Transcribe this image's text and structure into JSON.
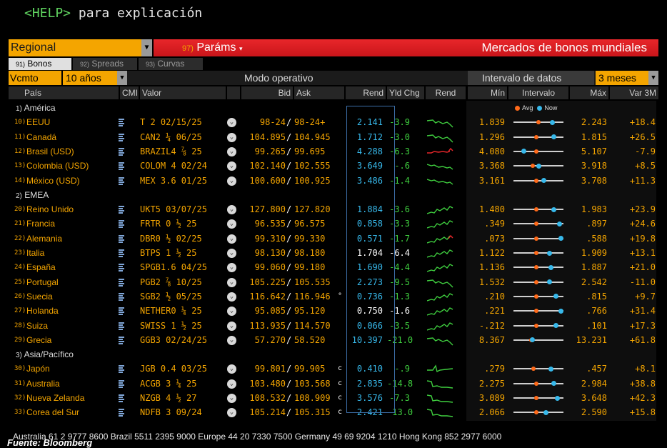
{
  "help": {
    "key": "<HELP>",
    "text": "para explicación"
  },
  "toolbar": {
    "region": "Regional",
    "params_num": "97)",
    "params_label": "Paráms",
    "title": "Mercados de bonos mundiales"
  },
  "tabs": [
    {
      "num": "91)",
      "label": "Bonos",
      "active": true
    },
    {
      "num": "92)",
      "label": "Spreads",
      "active": false
    },
    {
      "num": "93)",
      "label": "Curvas",
      "active": false
    }
  ],
  "controls": {
    "vcmto": "Vcmto",
    "anios": "10 años",
    "modo": "Modo operativo",
    "intervalo": "Intervalo de datos",
    "meses": "3 meses"
  },
  "headers": {
    "pais": "País",
    "cmi": "CMI",
    "valor": "Valor",
    "bid": "Bid",
    "ask": "Ask",
    "rend": "Rend",
    "yldchg": "Yld Chg",
    "rend2": "Rend",
    "min": "Mín",
    "intervalo": "Intervalo",
    "max": "Máx",
    "var": "Var 3M"
  },
  "legend": {
    "avg": "Avg",
    "now": "Now"
  },
  "colors": {
    "accent": "#f4a500",
    "blue": "#37b8ea",
    "green": "#3fcf3f",
    "red": "#e8262a",
    "orange_dot": "#ff6a1a"
  },
  "groups": [
    {
      "num": "1)",
      "name": "América"
    },
    {
      "num": "2)",
      "name": "EMEA"
    },
    {
      "num": "3)",
      "name": "Asia/Pacífico"
    }
  ],
  "rows": [
    {
      "n": "10)",
      "pais": "EEUU",
      "valor": "T 2 02/15/25",
      "bid": "98-24",
      "ask": "98-24+",
      "flag": "",
      "rend": "2.141",
      "chg": "-3.9",
      "min": "1.839",
      "max": "2.243",
      "var": "+18.4",
      "avg": 0.5,
      "now": 0.78,
      "rendwhite": false,
      "spark": "down"
    },
    {
      "n": "11)",
      "pais": "Canadá",
      "valor": "CAN2 ¼ 06/25",
      "bid": "104.895",
      "ask": "104.945",
      "flag": "",
      "rend": "1.712",
      "chg": "-3.0",
      "min": "1.296",
      "max": "1.815",
      "var": "+26.5",
      "avg": 0.45,
      "now": 0.8,
      "rendwhite": false,
      "spark": "down"
    },
    {
      "n": "12)",
      "pais": "Brasil (USD)",
      "valor": "BRAZIL4 ⅞ 25",
      "bid": "99.265",
      "ask": "99.695",
      "flag": "",
      "rend": "4.288",
      "chg": "-6.3",
      "min": "4.080",
      "max": "5.107",
      "var": "-7.9",
      "avg": 0.45,
      "now": 0.2,
      "rendwhite": false,
      "spark": "redflat"
    },
    {
      "n": "13)",
      "pais": "Colombia (USD)",
      "valor": "COLOM 4 02/24",
      "bid": "102.140",
      "ask": "102.555",
      "flag": "",
      "rend": "3.649",
      "chg": "-.6",
      "min": "3.368",
      "max": "3.918",
      "var": "+8.5",
      "avg": 0.38,
      "now": 0.51,
      "rendwhite": false,
      "spark": "flat"
    },
    {
      "n": "14)",
      "pais": "México (USD)",
      "valor": "MEX 3.6 01/25",
      "bid": "100.600",
      "ask": "100.925",
      "flag": "",
      "rend": "3.486",
      "chg": "-1.4",
      "min": "3.161",
      "max": "3.708",
      "var": "+11.3",
      "avg": 0.45,
      "now": 0.6,
      "rendwhite": false,
      "spark": "flat"
    },
    {
      "n": "20)",
      "pais": "Reino Unido",
      "valor": "UKT5 03/07/25",
      "bid": "127.800",
      "ask": "127.820",
      "flag": "",
      "rend": "1.884",
      "chg": "-3.6",
      "min": "1.480",
      "max": "1.983",
      "var": "+23.9",
      "avg": 0.45,
      "now": 0.8,
      "rendwhite": false,
      "spark": "up"
    },
    {
      "n": "21)",
      "pais": "Francia",
      "valor": "FRTR 0 ½ 25",
      "bid": "96.535",
      "ask": "96.575",
      "flag": "",
      "rend": "0.858",
      "chg": "-3.3",
      "min": ".349",
      "max": ".897",
      "var": "+24.6",
      "avg": 0.45,
      "now": 0.92,
      "rendwhite": false,
      "spark": "up"
    },
    {
      "n": "22)",
      "pais": "Alemania",
      "valor": "DBR0 ½ 02/25",
      "bid": "99.310",
      "ask": "99.330",
      "flag": "",
      "rend": "0.571",
      "chg": "-1.7",
      "min": ".073",
      "max": ".588",
      "var": "+19.8",
      "avg": 0.45,
      "now": 0.95,
      "rendwhite": false,
      "spark": "upred"
    },
    {
      "n": "23)",
      "pais": "Italia",
      "valor": "BTPS 1 ½ 25",
      "bid": "98.130",
      "ask": "98.180",
      "flag": "",
      "rend": "1.704",
      "chg": "-6.4",
      "min": "1.122",
      "max": "1.909",
      "var": "+13.1",
      "avg": 0.45,
      "now": 0.72,
      "rendwhite": true,
      "spark": "up"
    },
    {
      "n": "24)",
      "pais": "España",
      "valor": "SPGB1.6 04/25",
      "bid": "99.060",
      "ask": "99.180",
      "flag": "",
      "rend": "1.690",
      "chg": "-4.4",
      "min": "1.136",
      "max": "1.887",
      "var": "+21.0",
      "avg": 0.45,
      "now": 0.75,
      "rendwhite": false,
      "spark": "up"
    },
    {
      "n": "25)",
      "pais": "Portugal",
      "valor": "PGB2 ⅞ 10/25",
      "bid": "105.225",
      "ask": "105.535",
      "flag": "",
      "rend": "2.273",
      "chg": "-9.5",
      "min": "1.532",
      "max": "2.542",
      "var": "-11.0",
      "avg": 0.45,
      "now": 0.72,
      "rendwhite": false,
      "spark": "down"
    },
    {
      "n": "26)",
      "pais": "Suecia",
      "valor": "SGB2 ½ 05/25",
      "bid": "116.642",
      "ask": "116.946",
      "flag": "°",
      "rend": "0.736",
      "chg": "-1.3",
      "min": ".210",
      "max": ".815",
      "var": "+9.7",
      "avg": 0.45,
      "now": 0.85,
      "rendwhite": false,
      "spark": "up"
    },
    {
      "n": "27)",
      "pais": "Holanda",
      "valor": "NETHER0 ¼ 25",
      "bid": "95.085",
      "ask": "95.120",
      "flag": "",
      "rend": "0.750",
      "chg": "-1.6",
      "min": ".221",
      "max": ".766",
      "var": "+31.4",
      "avg": 0.45,
      "now": 0.95,
      "rendwhite": true,
      "spark": "up"
    },
    {
      "n": "28)",
      "pais": "Suiza",
      "valor": "SWISS 1 ½ 25",
      "bid": "113.935",
      "ask": "114.570",
      "flag": "",
      "rend": "0.066",
      "chg": "-3.5",
      "min": "-.212",
      "max": ".101",
      "var": "+17.3",
      "avg": 0.45,
      "now": 0.85,
      "rendwhite": false,
      "spark": "up"
    },
    {
      "n": "29)",
      "pais": "Grecia",
      "valor": "GGB3 02/24/25",
      "bid": "57.270",
      "ask": "58.520",
      "flag": "",
      "rend": "10.397",
      "chg": "-21.0",
      "min": "8.367",
      "max": "13.231",
      "var": "+61.8",
      "avg": 0.35,
      "now": 0.38,
      "rendwhite": false,
      "spark": "down"
    },
    {
      "n": "30)",
      "pais": "Japón",
      "valor": "JGB 0.4 03/25",
      "bid": "99.801",
      "ask": "99.905",
      "flag": "c",
      "rend": "0.410",
      "chg": "-.9",
      "min": ".279",
      "max": ".457",
      "var": "+8.1",
      "avg": 0.4,
      "now": 0.75,
      "rendwhite": false,
      "spark": "spike"
    },
    {
      "n": "31)",
      "pais": "Australia",
      "valor": "ACGB 3 ¼ 25",
      "bid": "103.480",
      "ask": "103.568",
      "flag": "c",
      "rend": "2.835",
      "chg": "-14.8",
      "min": "2.275",
      "max": "2.984",
      "var": "+38.8",
      "avg": 0.45,
      "now": 0.8,
      "rendwhite": false,
      "spark": "drop"
    },
    {
      "n": "32)",
      "pais": "Nueva Zelanda",
      "valor": "NZGB 4 ½ 27",
      "bid": "108.532",
      "ask": "108.909",
      "flag": "c",
      "rend": "3.576",
      "chg": "-7.3",
      "min": "3.089",
      "max": "3.648",
      "var": "+42.3",
      "avg": 0.45,
      "now": 0.88,
      "rendwhite": false,
      "spark": "drop"
    },
    {
      "n": "33)",
      "pais": "Corea del Sur",
      "valor": "NDFB 3 09/24",
      "bid": "105.214",
      "ask": "105.315",
      "flag": "c",
      "rend": "2.421",
      "chg": "-13.0",
      "min": "2.066",
      "max": "2.590",
      "var": "+15.8",
      "avg": 0.45,
      "now": 0.65,
      "rendwhite": false,
      "spark": "drop"
    }
  ],
  "ticker": "Australia 61 2 9777 8600 Brazil 5511 2395 9000 Europe 44 20 7330 7500 Germany 49 69 9204 1210 Hong Kong 852 2977 6000",
  "fuente": "Fuente: Bloomberg"
}
